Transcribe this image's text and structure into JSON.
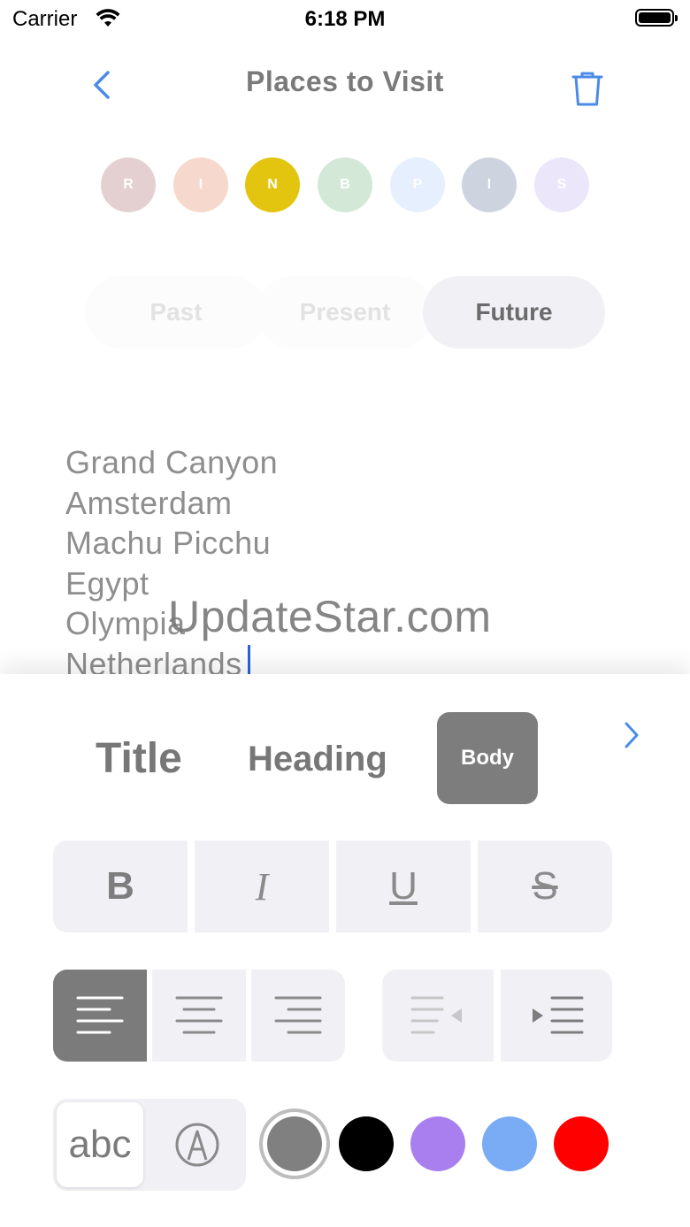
{
  "status_bar": {
    "carrier": "Carrier",
    "time": "6:18 PM"
  },
  "nav": {
    "title": "Places to Visit",
    "back_icon": "chevron-left-icon",
    "delete_icon": "trash-icon"
  },
  "color_tags": [
    {
      "letter": "R",
      "color": "#e4d0d0"
    },
    {
      "letter": "I",
      "color": "#f7d8cc"
    },
    {
      "letter": "N",
      "color": "#e3c50f"
    },
    {
      "letter": "B",
      "color": "#d3e8d6"
    },
    {
      "letter": "P",
      "color": "#e6effd"
    },
    {
      "letter": "I",
      "color": "#cdd3df"
    },
    {
      "letter": "S",
      "color": "#ece6fb"
    }
  ],
  "segments": {
    "past": "Past",
    "present": "Present",
    "future": "Future",
    "selected": "Future"
  },
  "notes": {
    "lines": [
      "Grand Canyon",
      "Amsterdam",
      "Machu Picchu",
      "Egypt",
      "Olympia",
      "Netherlands"
    ]
  },
  "watermark": "UpdateStar.com",
  "text_styles": {
    "title": "Title",
    "heading": "Heading",
    "body": "Body",
    "selected": "Body"
  },
  "format_buttons": {
    "bold": "B",
    "italic": "I",
    "underline": "U",
    "strike": "S"
  },
  "input_mode": {
    "keyboard_label": "abc",
    "pencil_icon": "pencil-tip-icon"
  },
  "text_colors": [
    "#808080",
    "#000000",
    "#a97ff0",
    "#7aabf5",
    "#ff0000"
  ],
  "accent": "#4a8be8"
}
